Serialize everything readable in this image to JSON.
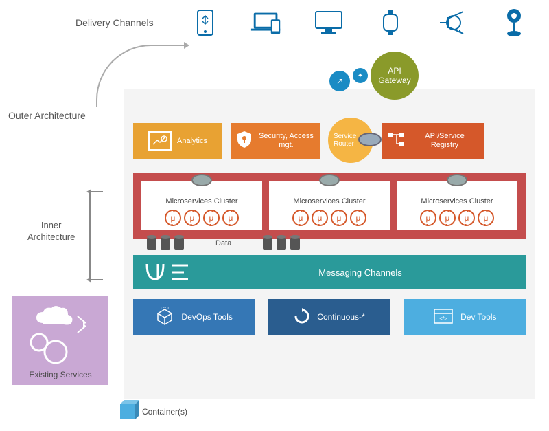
{
  "channels_label": "Delivery Channels",
  "outer_label": "Outer Architecture",
  "inner_label_l1": "Inner",
  "inner_label_l2": "Architecture",
  "api_gateway": "API Gateway",
  "cards": {
    "analytics": "Analytics",
    "security": "Security, Access mgt.",
    "router": "Service Router",
    "registry": "API/Service Registry"
  },
  "cluster_title": "Microservices Cluster",
  "mu": "μ",
  "data_label": "Data",
  "messaging": "Messaging Channels",
  "bottom": {
    "devops": "DevOps Tools",
    "continuous": "Continuous-*",
    "devtools": "Dev Tools"
  },
  "existing": "Existing Services",
  "containers": "Container(s)"
}
